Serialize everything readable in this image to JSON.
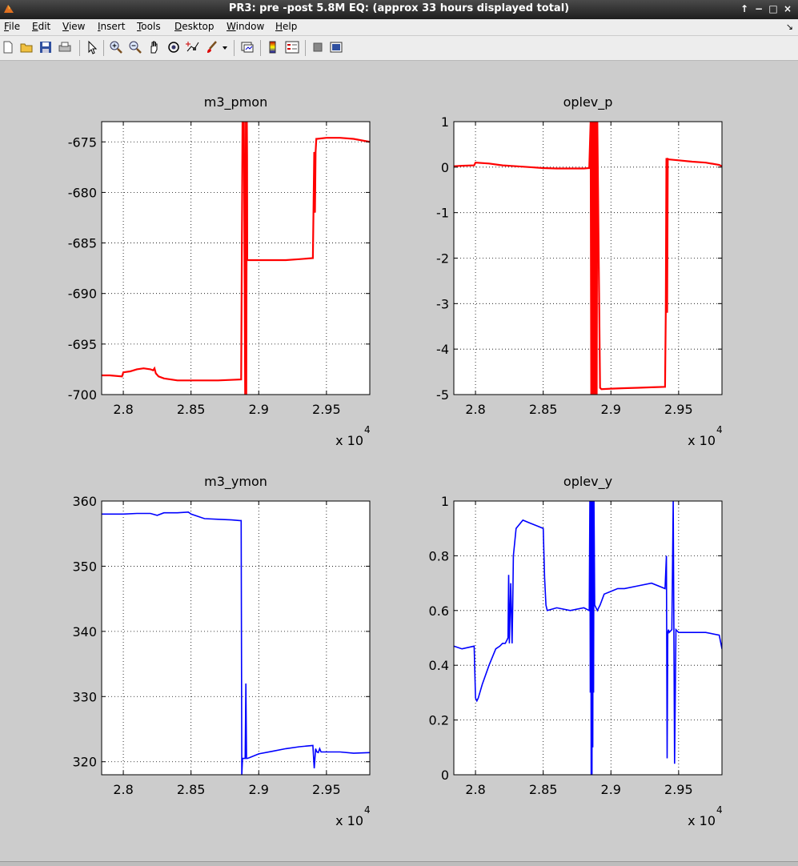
{
  "window": {
    "title": "PR3: pre -post 5.8M EQ: (approx 33 hours displayed total)"
  },
  "menu": [
    {
      "key": "F",
      "rest": "ile"
    },
    {
      "key": "E",
      "rest": "dit"
    },
    {
      "key": "V",
      "rest": "iew"
    },
    {
      "key": "I",
      "rest": "nsert"
    },
    {
      "key": "T",
      "rest": "ools"
    },
    {
      "key": "D",
      "rest": "esktop"
    },
    {
      "key": "W",
      "rest": "indow"
    },
    {
      "key": "H",
      "rest": "elp"
    }
  ],
  "toolbar": [
    {
      "icon": "new-file-icon"
    },
    {
      "icon": "open-folder-icon"
    },
    {
      "icon": "save-icon"
    },
    {
      "icon": "print-icon"
    },
    {
      "icon": "pointer-icon"
    },
    {
      "icon": "zoom-in-icon"
    },
    {
      "icon": "zoom-out-icon"
    },
    {
      "icon": "pan-hand-icon"
    },
    {
      "icon": "rotate-3d-icon"
    },
    {
      "icon": "data-cursor-icon"
    },
    {
      "icon": "brush-icon"
    },
    {
      "icon": "dropdown-arrow-icon"
    },
    {
      "icon": "link-plot-icon"
    },
    {
      "icon": "colorbar-icon"
    },
    {
      "icon": "legend-icon"
    },
    {
      "icon": "hide-plot-tools-icon"
    },
    {
      "icon": "show-plot-tools-icon"
    }
  ],
  "chart_data": [
    {
      "type": "line",
      "title": "m3_pmon",
      "color": "#ff0000",
      "xlim": [
        27840,
        29820
      ],
      "ylim": [
        -700,
        -673
      ],
      "xticks": [
        "2.8",
        "2.85",
        "2.9",
        "2.95"
      ],
      "xtick_values": [
        28000,
        28500,
        29000,
        29500
      ],
      "yticks": [
        "-675",
        "-680",
        "-685",
        "-690",
        "-695",
        "-700"
      ],
      "ytick_values": [
        -675,
        -680,
        -685,
        -690,
        -695,
        -700
      ],
      "exponent": "x 10",
      "exponent_power": "4",
      "grid": true,
      "x": [
        27840,
        27900,
        27990,
        28000,
        28050,
        28100,
        28150,
        28200,
        28220,
        28230,
        28240,
        28260,
        28300,
        28400,
        28500,
        28600,
        28700,
        28870,
        28880,
        28890,
        28900,
        28905,
        28908,
        28912,
        28914,
        28915,
        29000,
        29100,
        29200,
        29300,
        29400,
        29410,
        29415,
        29420,
        29425,
        29430,
        29500,
        29600,
        29700,
        29820
      ],
      "y": [
        -698.1,
        -698.1,
        -698.2,
        -697.8,
        -697.7,
        -697.5,
        -697.4,
        -697.5,
        -697.6,
        -697.4,
        -697.9,
        -698.2,
        -698.4,
        -698.6,
        -698.6,
        -698.6,
        -698.6,
        -698.5,
        -673,
        -673,
        -700,
        -673,
        -700,
        -673,
        -676.5,
        -686.7,
        -686.7,
        -686.7,
        -686.7,
        -686.6,
        -686.5,
        -676,
        -682,
        -676,
        -674.7,
        -674.7,
        -674.6,
        -674.6,
        -674.7,
        -675
      ]
    },
    {
      "type": "line",
      "title": "oplev_p",
      "color": "#ff0000",
      "xlim": [
        27840,
        29820
      ],
      "ylim": [
        -5,
        1
      ],
      "xticks": [
        "2.8",
        "2.85",
        "2.9",
        "2.95"
      ],
      "xtick_values": [
        28000,
        28500,
        29000,
        29500
      ],
      "yticks": [
        "1",
        "0",
        "-1",
        "-2",
        "-3",
        "-4",
        "-5"
      ],
      "ytick_values": [
        1,
        0,
        -1,
        -2,
        -3,
        -4,
        -5
      ],
      "exponent": "x 10",
      "exponent_power": "4",
      "grid": true,
      "x": [
        27840,
        27900,
        27990,
        28000,
        28100,
        28200,
        28300,
        28400,
        28500,
        28600,
        28700,
        28800,
        28840,
        28850,
        28855,
        28860,
        28865,
        28870,
        28875,
        28880,
        28885,
        28890,
        28895,
        28900,
        28920,
        28930,
        29000,
        29100,
        29200,
        29300,
        29400,
        29405,
        29410,
        29415,
        29420,
        29430,
        29500,
        29600,
        29700,
        29800,
        29820
      ],
      "y": [
        0.02,
        0.03,
        0.04,
        0.1,
        0.08,
        0.04,
        0.02,
        0.0,
        -0.02,
        -0.03,
        -0.03,
        -0.03,
        -0.02,
        1,
        -5,
        1,
        -5,
        1,
        -5,
        1,
        -5,
        1,
        -5,
        1,
        -4.85,
        -4.88,
        -4.87,
        -4.86,
        -4.85,
        -4.84,
        -4.83,
        -3.2,
        0.2,
        -3.2,
        0.18,
        0.17,
        0.15,
        0.12,
        0.1,
        0.05,
        0.02
      ]
    },
    {
      "type": "line",
      "title": "m3_ymon",
      "color": "#0000ff",
      "xlim": [
        27840,
        29820
      ],
      "ylim": [
        318,
        360
      ],
      "xticks": [
        "2.8",
        "2.85",
        "2.9",
        "2.95"
      ],
      "xtick_values": [
        28000,
        28500,
        29000,
        29500
      ],
      "yticks": [
        "360",
        "350",
        "340",
        "330",
        "320"
      ],
      "ytick_values": [
        360,
        350,
        340,
        330,
        320
      ],
      "exponent": "x 10",
      "exponent_power": "4",
      "grid": true,
      "x": [
        27840,
        27900,
        28000,
        28100,
        28200,
        28250,
        28300,
        28400,
        28480,
        28500,
        28600,
        28700,
        28800,
        28860,
        28870,
        28875,
        28880,
        28890,
        28900,
        28905,
        28910,
        28915,
        28930,
        29000,
        29100,
        29200,
        29300,
        29400,
        29410,
        29420,
        29430,
        29440,
        29450,
        29460,
        29500,
        29600,
        29700,
        29820
      ],
      "y": [
        358,
        358,
        358,
        358.1,
        358.1,
        357.8,
        358.2,
        358.2,
        358.3,
        358,
        357.3,
        357.2,
        357.1,
        357,
        357,
        318,
        320.5,
        320.5,
        320.5,
        332,
        320.5,
        320.5,
        320.6,
        321.2,
        321.6,
        322,
        322.3,
        322.5,
        319,
        322,
        321.5,
        321.4,
        322,
        321.5,
        321.5,
        321.5,
        321.3,
        321.4
      ]
    },
    {
      "type": "line",
      "title": "oplev_y",
      "color": "#0000ff",
      "xlim": [
        27840,
        29820
      ],
      "ylim": [
        0,
        1
      ],
      "xticks": [
        "2.8",
        "2.85",
        "2.9",
        "2.95"
      ],
      "xtick_values": [
        28000,
        28500,
        29000,
        29500
      ],
      "yticks": [
        "1",
        "0.8",
        "0.6",
        "0.4",
        "0.2",
        "0"
      ],
      "ytick_values": [
        1,
        0.8,
        0.6,
        0.4,
        0.2,
        0
      ],
      "exponent": "x 10",
      "exponent_power": "4",
      "grid": true,
      "x": [
        27840,
        27900,
        27990,
        28000,
        28010,
        28020,
        28050,
        28100,
        28150,
        28180,
        28200,
        28220,
        28240,
        28245,
        28250,
        28260,
        28270,
        28275,
        28280,
        28300,
        28350,
        28400,
        28450,
        28500,
        28510,
        28520,
        28530,
        28600,
        28700,
        28800,
        28840,
        28845,
        28848,
        28851,
        28854,
        28857,
        28860,
        28863,
        28866,
        28869,
        28872,
        28875,
        28880,
        28900,
        28920,
        28950,
        29000,
        29050,
        29100,
        29200,
        29300,
        29400,
        29410,
        29415,
        29420,
        29425,
        29430,
        29450,
        29460,
        29470,
        29480,
        29500,
        29600,
        29700,
        29800,
        29820
      ],
      "y": [
        0.47,
        0.46,
        0.47,
        0.28,
        0.27,
        0.28,
        0.33,
        0.4,
        0.46,
        0.47,
        0.48,
        0.48,
        0.5,
        0.73,
        0.48,
        0.7,
        0.48,
        0.62,
        0.8,
        0.9,
        0.93,
        0.92,
        0.91,
        0.9,
        0.72,
        0.62,
        0.6,
        0.61,
        0.6,
        0.61,
        0.6,
        1,
        0.3,
        1,
        0,
        1,
        0,
        1,
        0.1,
        1,
        0.3,
        1,
        0.62,
        0.6,
        0.62,
        0.66,
        0.67,
        0.68,
        0.68,
        0.69,
        0.7,
        0.68,
        0.8,
        0.06,
        0.52,
        0.53,
        0.52,
        0.53,
        1,
        0.04,
        0.53,
        0.52,
        0.52,
        0.52,
        0.51,
        0.46
      ]
    }
  ]
}
